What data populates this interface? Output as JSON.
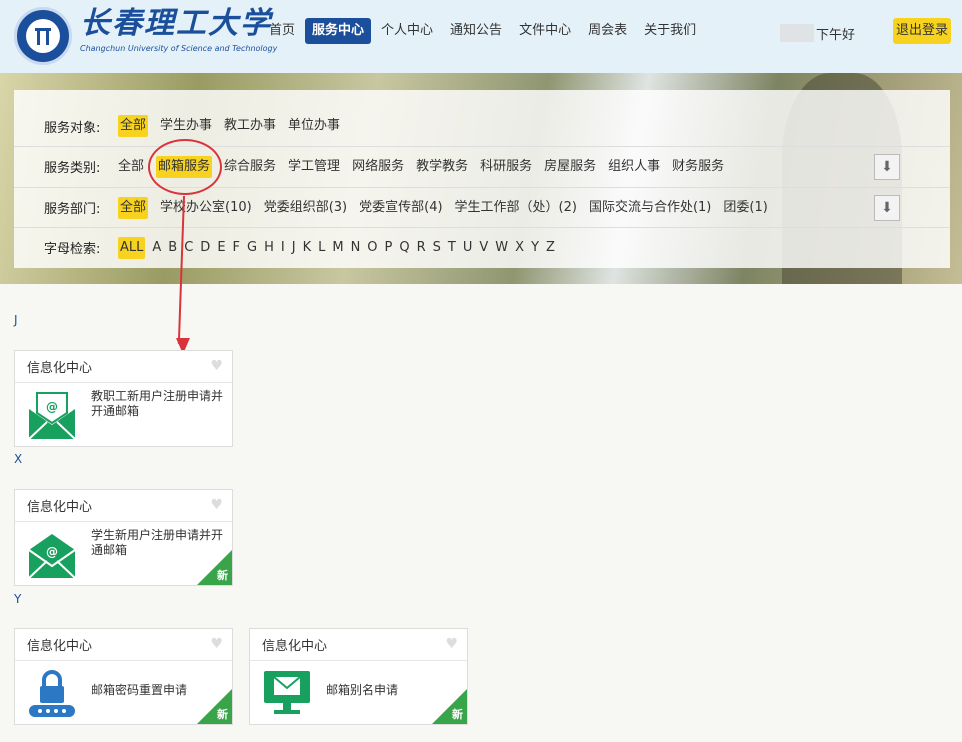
{
  "header": {
    "logo_cn": "长春理工大学",
    "logo_en": "Changchun University of Science and Technology",
    "nav": [
      "首页",
      "服务中心",
      "个人中心",
      "通知公告",
      "文件中心",
      "周会表",
      "关于我们"
    ],
    "active_nav": "服务中心",
    "greeting": "下午好",
    "logout": "退出登录"
  },
  "filters": {
    "target": {
      "label": "服务对象:",
      "options": [
        "全部",
        "学生办事",
        "教工办事",
        "单位办事"
      ],
      "selected": "全部"
    },
    "category": {
      "label": "服务类别:",
      "options": [
        "全部",
        "邮箱服务",
        "综合服务",
        "学工管理",
        "网络服务",
        "教学教务",
        "科研服务",
        "房屋服务",
        "组织人事",
        "财务服务"
      ],
      "selected": "邮箱服务"
    },
    "department": {
      "label": "服务部门:",
      "options": [
        "全部",
        "学校办公室(10)",
        "党委组织部(3)",
        "党委宣传部(4)",
        "学生工作部（处）(2)",
        "国际交流与合作处(1)",
        "团委(1)"
      ],
      "selected": "全部"
    },
    "letters": {
      "label": "字母检索:",
      "options": [
        "ALL",
        "A",
        "B",
        "C",
        "D",
        "E",
        "F",
        "G",
        "H",
        "I",
        "J",
        "K",
        "L",
        "M",
        "N",
        "O",
        "P",
        "Q",
        "R",
        "S",
        "T",
        "U",
        "V",
        "W",
        "X",
        "Y",
        "Z"
      ],
      "selected": "ALL"
    }
  },
  "groups": [
    {
      "letter": "J",
      "cards": [
        {
          "dept": "信息化中心",
          "title": "教职工新用户注册申请并开通邮箱",
          "icon": "envelope-at-icon",
          "new": false
        }
      ]
    },
    {
      "letter": "X",
      "cards": [
        {
          "dept": "信息化中心",
          "title": "学生新用户注册申请并开通邮箱",
          "icon": "envelope-at-icon",
          "new": true,
          "new_label": "新"
        }
      ]
    },
    {
      "letter": "Y",
      "cards": [
        {
          "dept": "信息化中心",
          "title": "邮箱密码重置申请",
          "icon": "lock-password-icon",
          "new": true,
          "new_label": "新"
        },
        {
          "dept": "信息化中心",
          "title": "邮箱别名申请",
          "icon": "monitor-mail-icon",
          "new": true,
          "new_label": "新"
        }
      ]
    }
  ],
  "colors": {
    "brand_blue": "#1b4f9c",
    "highlight_yellow": "#f7d320",
    "icon_green": "#17a05e",
    "new_green": "#3aa44b",
    "annotation_red": "#d9343b"
  }
}
